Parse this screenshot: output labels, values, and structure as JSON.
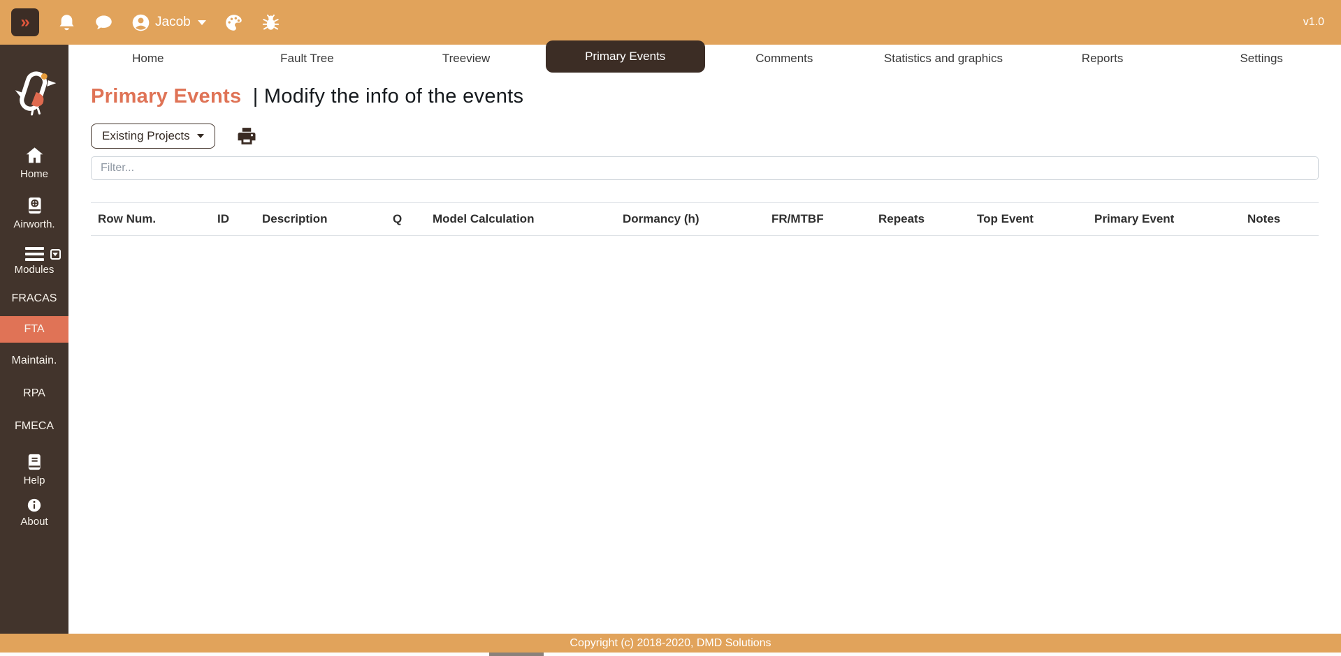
{
  "topbar": {
    "expand_button": "»",
    "username": "Jacob",
    "version": "v1.0",
    "icon_names": [
      "bell-icon",
      "chat-icon",
      "user-icon",
      "palette-icon",
      "bug-icon"
    ]
  },
  "sidebar": {
    "logo": "robin-bird-logo",
    "items": [
      {
        "label": "Home",
        "icon": "home-icon",
        "active": false
      },
      {
        "label": "Airworth.",
        "icon": "airworthiness-book-icon",
        "active": false
      },
      {
        "label": "Modules",
        "icon": "modules-menu-icon",
        "active": false
      },
      {
        "label": "FRACAS",
        "icon": null,
        "active": false
      },
      {
        "label": "FTA",
        "icon": null,
        "active": true
      },
      {
        "label": "Maintain.",
        "icon": null,
        "active": false
      },
      {
        "label": "RPA",
        "icon": null,
        "active": false
      },
      {
        "label": "FMECA",
        "icon": null,
        "active": false
      },
      {
        "label": "Help",
        "icon": "help-book-icon",
        "active": false
      },
      {
        "label": "About",
        "icon": "about-info-icon",
        "active": false
      }
    ]
  },
  "tabs": {
    "active": "Primary Events",
    "items": [
      {
        "label": "Home"
      },
      {
        "label": "Fault Tree"
      },
      {
        "label": "Treeview"
      },
      {
        "label": "Primary Events"
      },
      {
        "label": "Comments"
      },
      {
        "label": "Statistics and graphics"
      },
      {
        "label": "Reports"
      },
      {
        "label": "Settings"
      }
    ]
  },
  "page_header": {
    "title": "Primary Events",
    "subtitle": "| Modify the info of the events"
  },
  "toolbar": {
    "existing_projects_label": "Existing Projects",
    "printer_icon": "printer-icon"
  },
  "filter": {
    "placeholder": "Filter..."
  },
  "table": {
    "headers": [
      "Row Num.",
      "ID",
      "Description",
      "Q",
      "Model Calculation",
      "Dormancy (h)",
      "FR/MTBF",
      "Repeats",
      "Top Event",
      "Primary Event",
      "Notes"
    ],
    "rows": []
  },
  "footer": {
    "copyright": "Copyright (c) 2018-2020, DMD Solutions"
  },
  "colors": {
    "topbar_orange": "#e1a35b",
    "sidebar_brown": "#42342c",
    "active_dark": "#3c2d25",
    "accent_coral": "#df7356",
    "fta_highlight": "#e07356",
    "chevron_red": "#e2573d"
  }
}
